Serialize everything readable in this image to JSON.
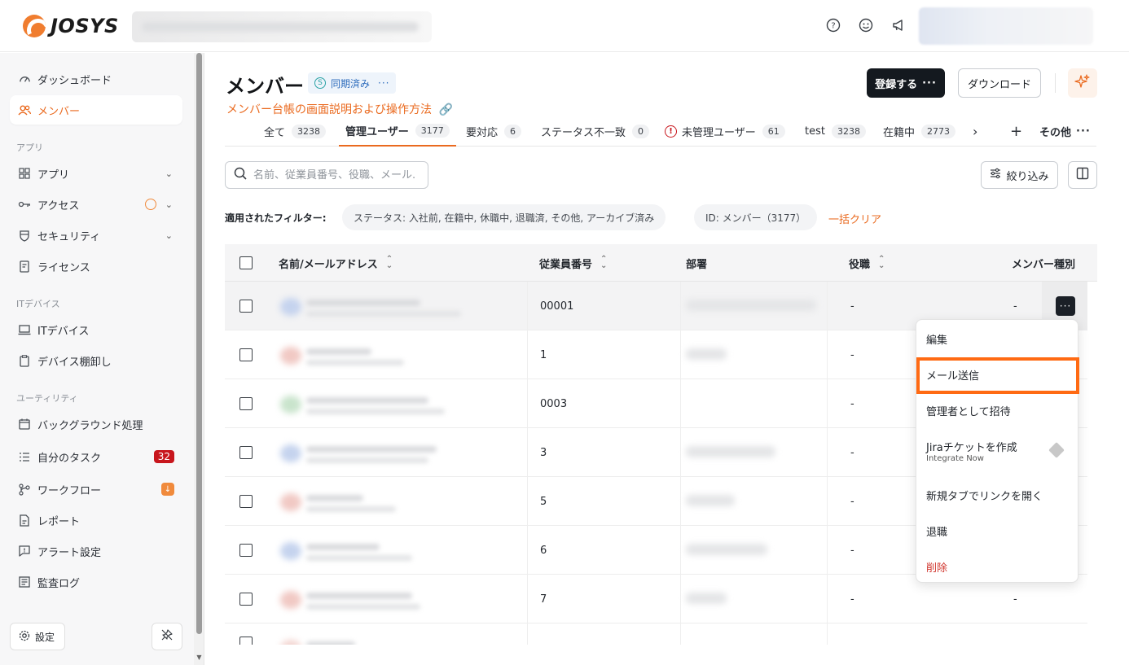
{
  "header": {
    "logo_text": "JOSYS",
    "icons": [
      "help-icon",
      "emoji-icon",
      "megaphone-icon"
    ]
  },
  "sidebar": {
    "items": [
      {
        "label": "ダッシュボード",
        "icon": "gauge-icon"
      },
      {
        "label": "メンバー",
        "icon": "users-icon",
        "active": true
      }
    ],
    "sections": [
      {
        "title": "アプリ",
        "items": [
          {
            "label": "アプリ",
            "icon": "grid-icon"
          },
          {
            "label": "アクセス",
            "icon": "key-icon"
          },
          {
            "label": "セキュリティ",
            "icon": "shield-icon"
          },
          {
            "label": "ライセンス",
            "icon": "license-icon"
          }
        ]
      },
      {
        "title": "ITデバイス",
        "items": [
          {
            "label": "ITデバイス",
            "icon": "laptop-icon"
          },
          {
            "label": "デバイス棚卸し",
            "icon": "clipboard-icon"
          }
        ]
      },
      {
        "title": "ユーティリティ",
        "items": [
          {
            "label": "バックグラウンド処理",
            "icon": "calendar-icon"
          },
          {
            "label": "自分のタスク",
            "icon": "tasks-icon",
            "badge": "32"
          },
          {
            "label": "ワークフロー",
            "icon": "workflow-icon"
          },
          {
            "label": "レポート",
            "icon": "report-icon"
          },
          {
            "label": "アラート設定",
            "icon": "alert-icon"
          },
          {
            "label": "監査ログ",
            "icon": "audit-icon"
          }
        ]
      }
    ],
    "settings_label": "設定"
  },
  "main": {
    "title": "メンバー",
    "sync_status": "同期済み",
    "help_link": "メンバー台帳の画面説明および操作方法",
    "register_button": "登録する",
    "download_button": "ダウンロード",
    "tabs": [
      {
        "label": "全て",
        "count": "3238"
      },
      {
        "label": "管理ユーザー",
        "count": "3177",
        "active": true
      },
      {
        "label": "要対応",
        "count": "6"
      },
      {
        "label": "ステータス不一致",
        "count": "0"
      },
      {
        "label": "未管理ユーザー",
        "count": "61"
      },
      {
        "label": "test",
        "count": "3238"
      },
      {
        "label": "在籍中",
        "count": "2773"
      }
    ],
    "tabs_more": "その他",
    "search_placeholder": "名前、従業員番号、役職、メール...",
    "filter_button": "絞り込み",
    "applied_filters_label": "適用されたフィルター:",
    "filter_chips": [
      "ステータス: 入社前, 在籍中, 休職中, 退職済, その他, アーカイブ済み",
      "ID: メンバー（3177）"
    ],
    "clear_all": "一括クリア",
    "table": {
      "columns": [
        "名前/メールアドレス",
        "従業員番号",
        "部署",
        "役職",
        "メンバー種別"
      ],
      "rows": [
        {
          "employee_no": "00001",
          "role": "-",
          "type": "-"
        },
        {
          "employee_no": "1",
          "role": "-",
          "type": ""
        },
        {
          "employee_no": "0003",
          "role": "-",
          "type": ""
        },
        {
          "employee_no": "3",
          "role": "-",
          "type": ""
        },
        {
          "employee_no": "5",
          "role": "-",
          "type": ""
        },
        {
          "employee_no": "6",
          "role": "-",
          "type": ""
        },
        {
          "employee_no": "7",
          "role": "-",
          "type": "-"
        }
      ]
    },
    "row_menu": {
      "items": [
        "編集",
        "メール送信",
        "管理者として招待",
        "Jiraチケットを作成",
        "新規タブでリンクを開く",
        "退職",
        "削除"
      ],
      "jira_sub": "Integrate Now",
      "highlighted": "メール送信"
    }
  },
  "colors": {
    "accent": "#ea6a1f",
    "dark_button": "#14191f",
    "danger": "#d0342c",
    "highlight_border": "#ff6a13"
  }
}
